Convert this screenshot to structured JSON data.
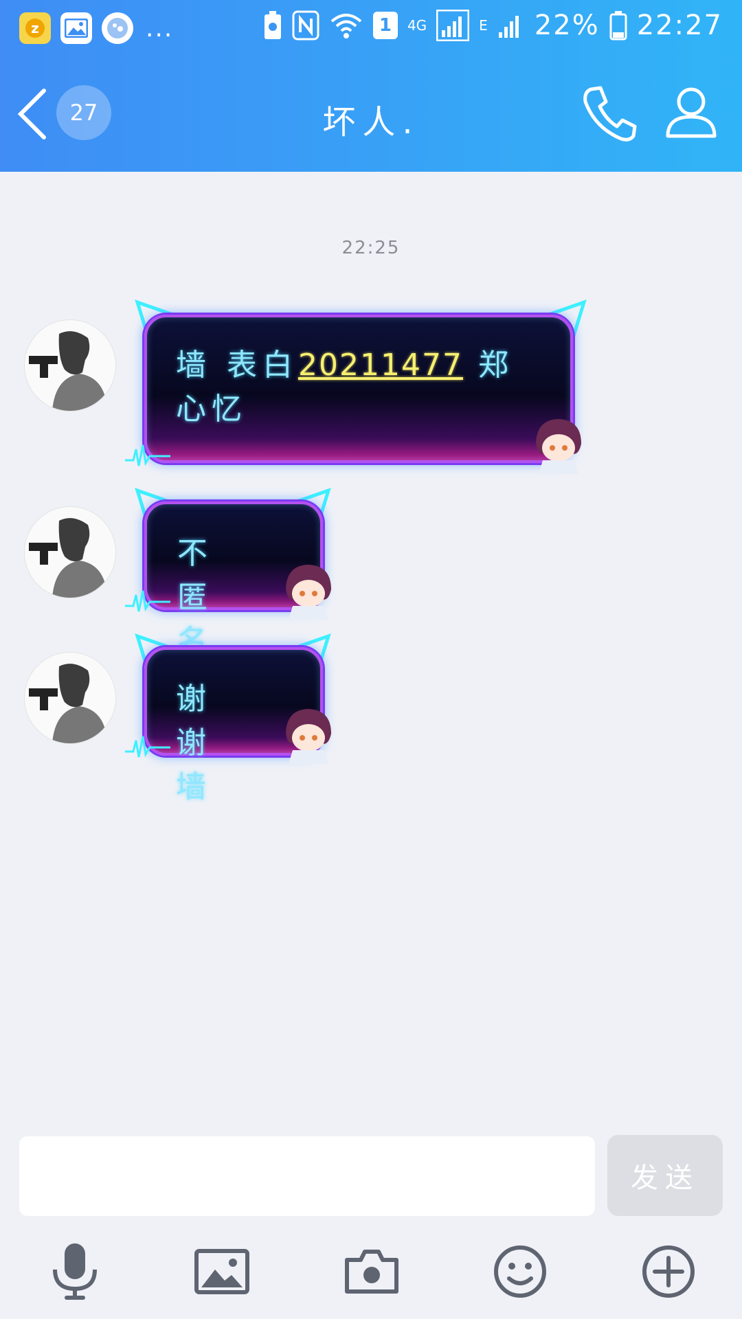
{
  "status_bar": {
    "network": "4G",
    "sim_slot": "1",
    "edge": "E",
    "battery": "22%",
    "time": "22:27",
    "more": "..."
  },
  "header": {
    "unread_count": "27",
    "title": "坏人."
  },
  "chat": {
    "timestamp": "22:25",
    "messages": [
      {
        "text_prefix": "墙 表白",
        "text_number": "20211477",
        "text_suffix": " 郑心忆"
      },
      {
        "text": "不匿名"
      },
      {
        "text": "谢谢墙"
      }
    ]
  },
  "composer": {
    "input_value": "",
    "send_label": "发送"
  },
  "colors": {
    "header_start": "#3f8df5",
    "header_end": "#31b4f7",
    "chat_bg": "#eff1f7",
    "bubble_text": "#8fe7ff",
    "link_number": "#f7f070"
  },
  "icons": {
    "back": "chevron-left-icon",
    "call": "phone-icon",
    "profile": "person-icon",
    "toolbar": [
      "microphone-icon",
      "image-icon",
      "camera-icon",
      "emoji-icon",
      "plus-circle-icon"
    ]
  }
}
